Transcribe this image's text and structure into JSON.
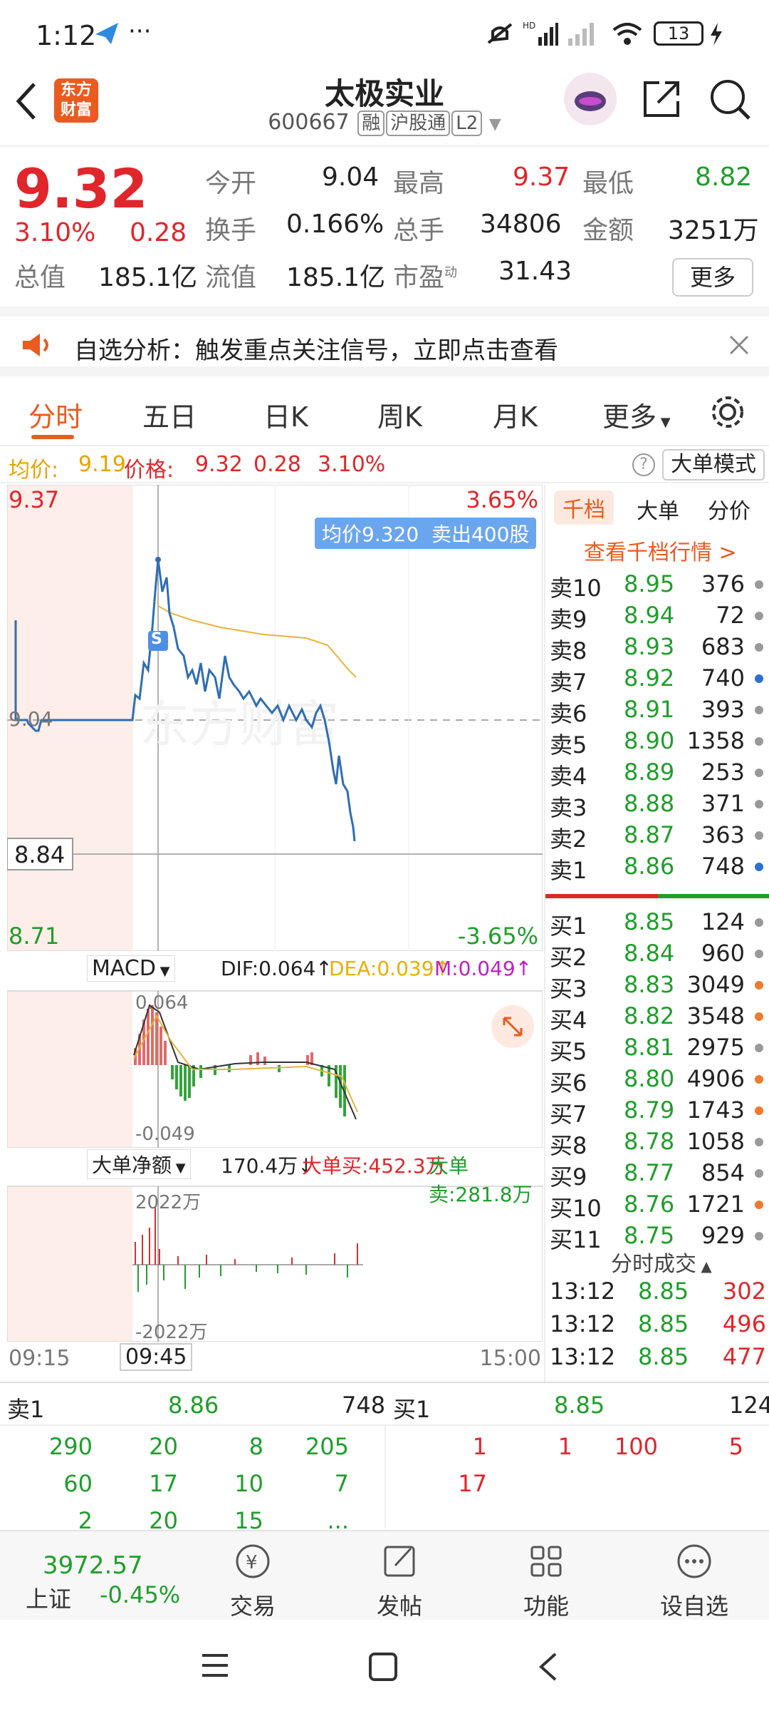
{
  "status": {
    "time": "1:12",
    "dots": "···",
    "battery": "13"
  },
  "header": {
    "title": "太极实业",
    "code": "600667",
    "tags": [
      "融",
      "沪股通",
      "L2"
    ],
    "logo": "东方财富"
  },
  "quote": {
    "price": "9.32",
    "pct": "3.10%",
    "chg": "0.28",
    "labels": {
      "open": "今开",
      "high": "最高",
      "low": "最低",
      "turnover": "换手",
      "volume": "总手",
      "amount": "金额",
      "mktcap": "总值",
      "float": "流值",
      "pe": "市盈",
      "pe_sup": "动"
    },
    "values": {
      "open": "9.04",
      "high": "9.37",
      "low": "8.82",
      "turnover": "0.166%",
      "volume": "34806",
      "amount": "3251万",
      "mktcap": "185.1亿",
      "float": "185.1亿",
      "pe": "31.43"
    },
    "more": "更多"
  },
  "notice": {
    "text": "自选分析：触发重点关注信号，立即点击查看"
  },
  "tabs": [
    "分时",
    "五日",
    "日K",
    "周K",
    "月K",
    "更多"
  ],
  "avgline": {
    "avg_label": "均价:",
    "avg": "9.19",
    "price_label": "价格:",
    "price": "9.32",
    "chg": "0.28",
    "pct": "3.10%",
    "mode": "大单模式"
  },
  "chart": {
    "top_price": "9.37",
    "top_pct": "3.65%",
    "bottom_price": "8.71",
    "bottom_pct": "-3.65%",
    "mid_price": "9.04",
    "cursor_price": "8.84",
    "tooltip": "均价9.320  卖出400股",
    "sell_marker": "S",
    "watermark": "东方财富",
    "time_start": "09:15",
    "time_cursor": "09:45",
    "time_end": "15:00"
  },
  "macd": {
    "label": "MACD",
    "dif": "DIF:0.064↑",
    "dea": "DEA:0.039↑",
    "m": "M:0.049↑",
    "top": "0.064",
    "bottom": "-0.049"
  },
  "bigorder": {
    "label": "大单净额",
    "net": "170.4万↓",
    "buy": "大单买:452.3万",
    "sell": "大单卖:281.8万",
    "top": "2022万",
    "bottom": "-2022万"
  },
  "orderbook": {
    "tabs": [
      "千档",
      "大单",
      "分价"
    ],
    "link": "查看千档行情 >",
    "sells": [
      {
        "label": "卖10",
        "price": "8.95",
        "vol": "376",
        "dot": "#999"
      },
      {
        "label": "卖9",
        "price": "8.94",
        "vol": "72",
        "dot": "#999"
      },
      {
        "label": "卖8",
        "price": "8.93",
        "vol": "683",
        "dot": "#999"
      },
      {
        "label": "卖7",
        "price": "8.92",
        "vol": "740",
        "dot": "#2d6fd0"
      },
      {
        "label": "卖6",
        "price": "8.91",
        "vol": "393",
        "dot": "#999"
      },
      {
        "label": "卖5",
        "price": "8.90",
        "vol": "1358",
        "dot": "#999"
      },
      {
        "label": "卖4",
        "price": "8.89",
        "vol": "253",
        "dot": "#999"
      },
      {
        "label": "卖3",
        "price": "8.88",
        "vol": "371",
        "dot": "#999"
      },
      {
        "label": "卖2",
        "price": "8.87",
        "vol": "363",
        "dot": "#999"
      },
      {
        "label": "卖1",
        "price": "8.86",
        "vol": "748",
        "dot": "#2d6fd0"
      }
    ],
    "buys": [
      {
        "label": "买1",
        "price": "8.85",
        "vol": "124",
        "dot": "#999"
      },
      {
        "label": "买2",
        "price": "8.84",
        "vol": "960",
        "dot": "#999"
      },
      {
        "label": "买3",
        "price": "8.83",
        "vol": "3049",
        "dot": "#f07a2b"
      },
      {
        "label": "买4",
        "price": "8.82",
        "vol": "3548",
        "dot": "#f07a2b"
      },
      {
        "label": "买5",
        "price": "8.81",
        "vol": "2975",
        "dot": "#999"
      },
      {
        "label": "买6",
        "price": "8.80",
        "vol": "4906",
        "dot": "#f07a2b"
      },
      {
        "label": "买7",
        "price": "8.79",
        "vol": "1743",
        "dot": "#f07a2b"
      },
      {
        "label": "买8",
        "price": "8.78",
        "vol": "1058",
        "dot": "#999"
      },
      {
        "label": "买9",
        "price": "8.77",
        "vol": "854",
        "dot": "#999"
      },
      {
        "label": "买10",
        "price": "8.76",
        "vol": "1721",
        "dot": "#f07a2b"
      },
      {
        "label": "买11",
        "price": "8.75",
        "vol": "929",
        "dot": "#999"
      }
    ],
    "trades_title": "分时成交",
    "trades": [
      {
        "time": "13:12",
        "price": "8.85",
        "vol": "302"
      },
      {
        "time": "13:12",
        "price": "8.85",
        "vol": "496"
      },
      {
        "time": "13:12",
        "price": "8.85",
        "vol": "477"
      }
    ]
  },
  "queue": {
    "sell_label": "卖1",
    "sell_price": "8.86",
    "sell_total": "748",
    "buy_label": "买1",
    "buy_price": "8.85",
    "buy_total": "124",
    "sell_rows": [
      [
        "290",
        "20",
        "8",
        "205"
      ],
      [
        "60",
        "17",
        "10",
        "7"
      ],
      [
        "2",
        "20",
        "15",
        "..."
      ]
    ],
    "buy_rows": [
      [
        "1",
        "1",
        "100",
        "5"
      ],
      [
        "17",
        "",
        "",
        ""
      ]
    ]
  },
  "dock": {
    "index_value": "3972.57",
    "index_name": "上证",
    "index_pct": "-0.45%",
    "items": [
      "交易",
      "发帖",
      "功能",
      "设自选"
    ]
  }
}
